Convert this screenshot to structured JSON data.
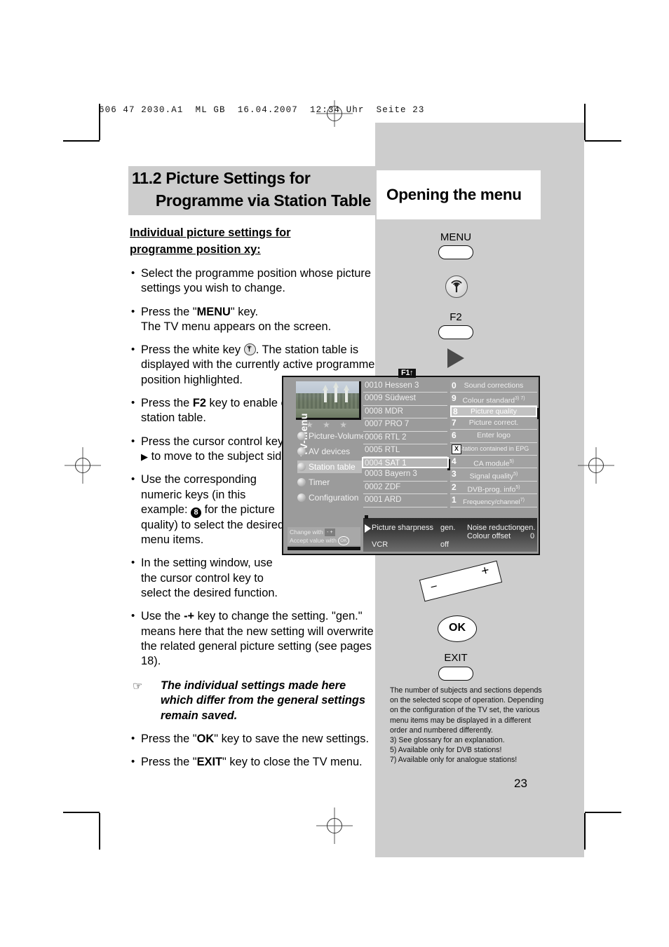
{
  "page": {
    "code_line": "606 47 2030.A1  ML GB  16.04.2007  12:34 Uhr  Seite 23",
    "number": "23"
  },
  "titles": {
    "left_line1": "11.2 Picture Settings for",
    "left_line2": "Programme via Station Table",
    "right": "Opening the menu"
  },
  "left_column": {
    "heading_line1": "Individual picture settings for",
    "heading_line2": "programme position xy:",
    "b1": "Select the programme position whose picture settings you wish to change.",
    "b2_a": "Press the \"",
    "b2_key": "MENU",
    "b2_b": "\" key.",
    "b2_c": "The TV menu appears on the screen.",
    "b3_a": "Press the white key",
    "b3_b": ". The station table is displayed with the currently active programme position highlighted.",
    "b4_a": "Press the",
    "b4_key": "F2",
    "b4_b": "key to enable editing of the station table.",
    "b5_a": "Press the cursor control key",
    "b5_arrow": "▶",
    "b5_b": "to move to the subject side.",
    "b6_a": "Use the corresponding numeric keys (in this example:",
    "b6_num": "8",
    "b6_b": "for the picture quality) to select the desired menu items.",
    "b7": "In the setting window, use the cursor control key to select the desired function.",
    "b8_a": "Use the",
    "b8_minus": "-",
    "b8_plus": "+",
    "b8_b": "key to change the setting. \"gen.\" means here that the new setting will overwrite the related general picture setting (see pages 18).",
    "note": "The individual settings made here which differ from the general settings remain saved.",
    "b9_a": "Press the \"",
    "b9_key": "OK",
    "b9_b": "\" key to save the new settings.",
    "b10_a": "Press the \"",
    "b10_key": "EXIT",
    "b10_b": "\" key to close the TV menu."
  },
  "keys": {
    "menu": "MENU",
    "f2": "F2",
    "ok": "OK",
    "exit": "EXIT",
    "minus": "−",
    "plus": "+"
  },
  "tv": {
    "f1_tag": "F1",
    "f1_arrow": "↑",
    "vertical_label": "TV-Menu",
    "stars": "★ ★ ★",
    "menu_items": [
      {
        "label": "Picture-Volume",
        "selected": false
      },
      {
        "label": "AV devices",
        "selected": false
      },
      {
        "label": "Station table",
        "selected": true
      },
      {
        "label": "Timer",
        "selected": false
      },
      {
        "label": "Configuration",
        "selected": false
      }
    ],
    "stations": [
      {
        "num": "0010",
        "name": "Hessen 3",
        "selected": false
      },
      {
        "num": "0009",
        "name": "Südwest",
        "selected": false
      },
      {
        "num": "0008",
        "name": "MDR",
        "selected": false
      },
      {
        "num": "0007",
        "name": "PRO 7",
        "selected": false
      },
      {
        "num": "0006",
        "name": "RTL 2",
        "selected": false
      },
      {
        "num": "0005",
        "name": "RTL",
        "selected": false
      },
      {
        "num": "0004",
        "name": "SAT 1",
        "selected": true
      },
      {
        "num": "0003",
        "name": "Bayern 3",
        "selected": false
      },
      {
        "num": "0002",
        "name": "ZDF",
        "selected": false
      },
      {
        "num": "0001",
        "name": "ARD",
        "selected": false
      }
    ],
    "subjects": [
      {
        "key": "0",
        "label": "Sound corrections",
        "sup": "",
        "selected": false
      },
      {
        "key": "9",
        "label": "Colour standard",
        "sup": "3) 7)",
        "selected": false
      },
      {
        "key": "8",
        "label": "Picture quality",
        "sup": "",
        "selected": true
      },
      {
        "key": "7",
        "label": "Picture correct.",
        "sup": "",
        "selected": false
      },
      {
        "key": "6",
        "label": "Enter logo",
        "sup": "",
        "selected": false
      },
      {
        "key": "X",
        "label": "Station contained in EPG",
        "sup": "",
        "selected": false
      },
      {
        "key": "4",
        "label": "CA module",
        "sup": "5)",
        "selected": false
      },
      {
        "key": "3",
        "label": "Signal quality",
        "sup": "5)",
        "selected": false
      },
      {
        "key": "2",
        "label": "DVB-prog. info",
        "sup": "5)",
        "selected": false
      },
      {
        "key": "1",
        "label": "Frequency/channel",
        "sup": "7)",
        "selected": false
      }
    ],
    "hint_line1": "Change with",
    "hint_pm": "- +",
    "hint_line2": "Accept value with",
    "hint_ok": "OK",
    "settings": {
      "s1_label": "Picture sharpness",
      "s1_value": "gen.",
      "s2_label": "Noise reduction",
      "s2_value": "gen.",
      "s3_label": "Colour offset",
      "s3_value": "0",
      "s4_label": "VCR",
      "s4_value": "off"
    }
  },
  "footnotes": {
    "para": "The number of subjects and sections depends on the selected scope of operation. Depending on the configuration of the TV set, the various menu items may be displayed in a different order and numbered differently.",
    "f3": "3) See glossary for an explanation.",
    "f5": "5) Available only for DVB stations!",
    "f7": "7) Available only for analogue stations!"
  }
}
